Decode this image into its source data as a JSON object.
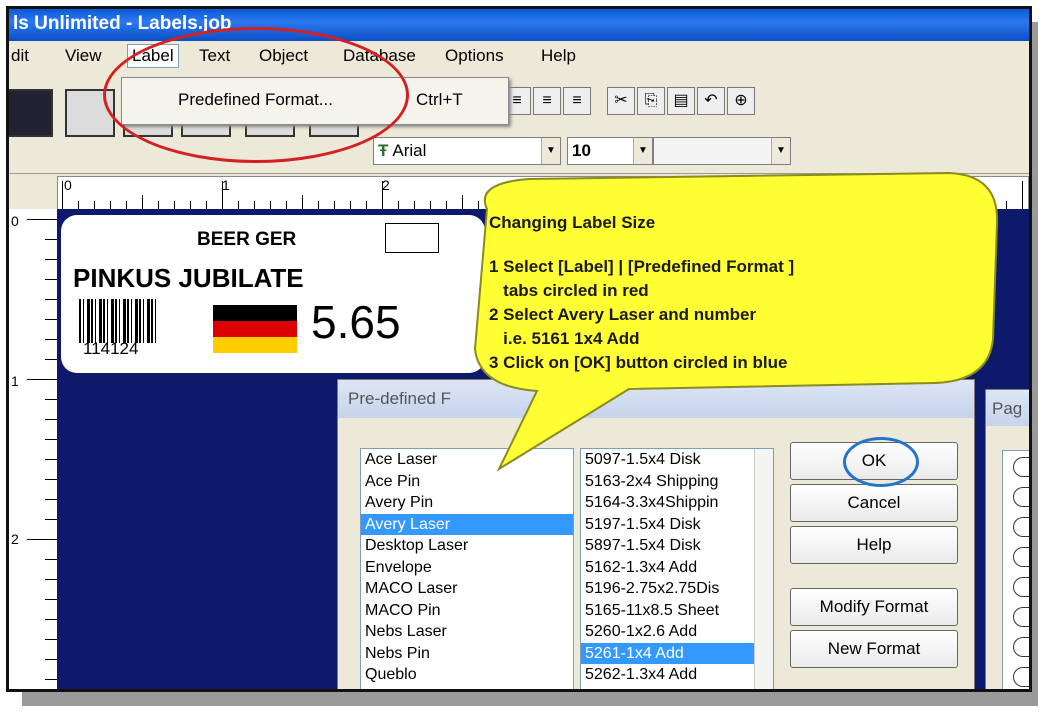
{
  "window": {
    "title": "ls Unlimited - Labels.job"
  },
  "menu": {
    "items": [
      "dit",
      "View",
      "Label",
      "Text",
      "Object",
      "Database",
      "Options",
      "Help"
    ],
    "active": "Label"
  },
  "dropdown": {
    "label": "Predefined Format...",
    "shortcut": "Ctrl+T"
  },
  "toolbar": {
    "font": "Arial",
    "size": "10",
    "extra": ""
  },
  "ruler": {
    "marks": [
      "0",
      "1",
      "2"
    ]
  },
  "vruler": {
    "marks": [
      "0",
      "1",
      "2"
    ]
  },
  "label_card": {
    "store": "BEER GER",
    "product": "PINKUS JUBILATE",
    "barcode_number": "114124",
    "price": "5.65",
    "flag_colors": [
      "#000000",
      "#dd0000",
      "#ffce00"
    ]
  },
  "dialog": {
    "title": "Pre-defined F",
    "brands": [
      "Ace Laser",
      "Ace Pin",
      "Avery Pin",
      "Avery Laser",
      "Desktop Laser",
      "Envelope",
      "MACO Laser",
      "MACO Pin",
      "Nebs Laser",
      "Nebs Pin",
      "Queblo"
    ],
    "selected_brand": "Avery Laser",
    "formats": [
      "5097-1.5x4 Disk",
      "5163-2x4 Shipping",
      "5164-3.3x4Shippin",
      "5197-1.5x4 Disk",
      "5897-1.5x4 Disk",
      "5162-1.3x4 Add",
      "5196-2.75x2.75Dis",
      "5165-11x8.5 Sheet",
      "5260-1x2.6 Add",
      "5261-1x4 Add",
      "5262-1.3x4 Add"
    ],
    "selected_format": "5261-1x4 Add",
    "buttons": {
      "ok": "OK",
      "cancel": "Cancel",
      "help": "Help",
      "modify": "Modify Format",
      "new": "New Format"
    }
  },
  "page_dialog": {
    "title": "Pag"
  },
  "callout": {
    "title": "Changing Label Size",
    "lines": [
      "1 Select [Label] | [Predefined Format ]",
      "   tabs circled in red",
      "2 Select Avery Laser and number",
      "   i.e. 5161 1x4 Add",
      "3 Click on [OK] button circled in blue"
    ]
  },
  "colors": {
    "highlight": "#3399ff",
    "callout_fill": "#ffff33",
    "red_circle": "#d42020",
    "blue_circle": "#2474c9",
    "workspace": "#0d1a6b"
  }
}
